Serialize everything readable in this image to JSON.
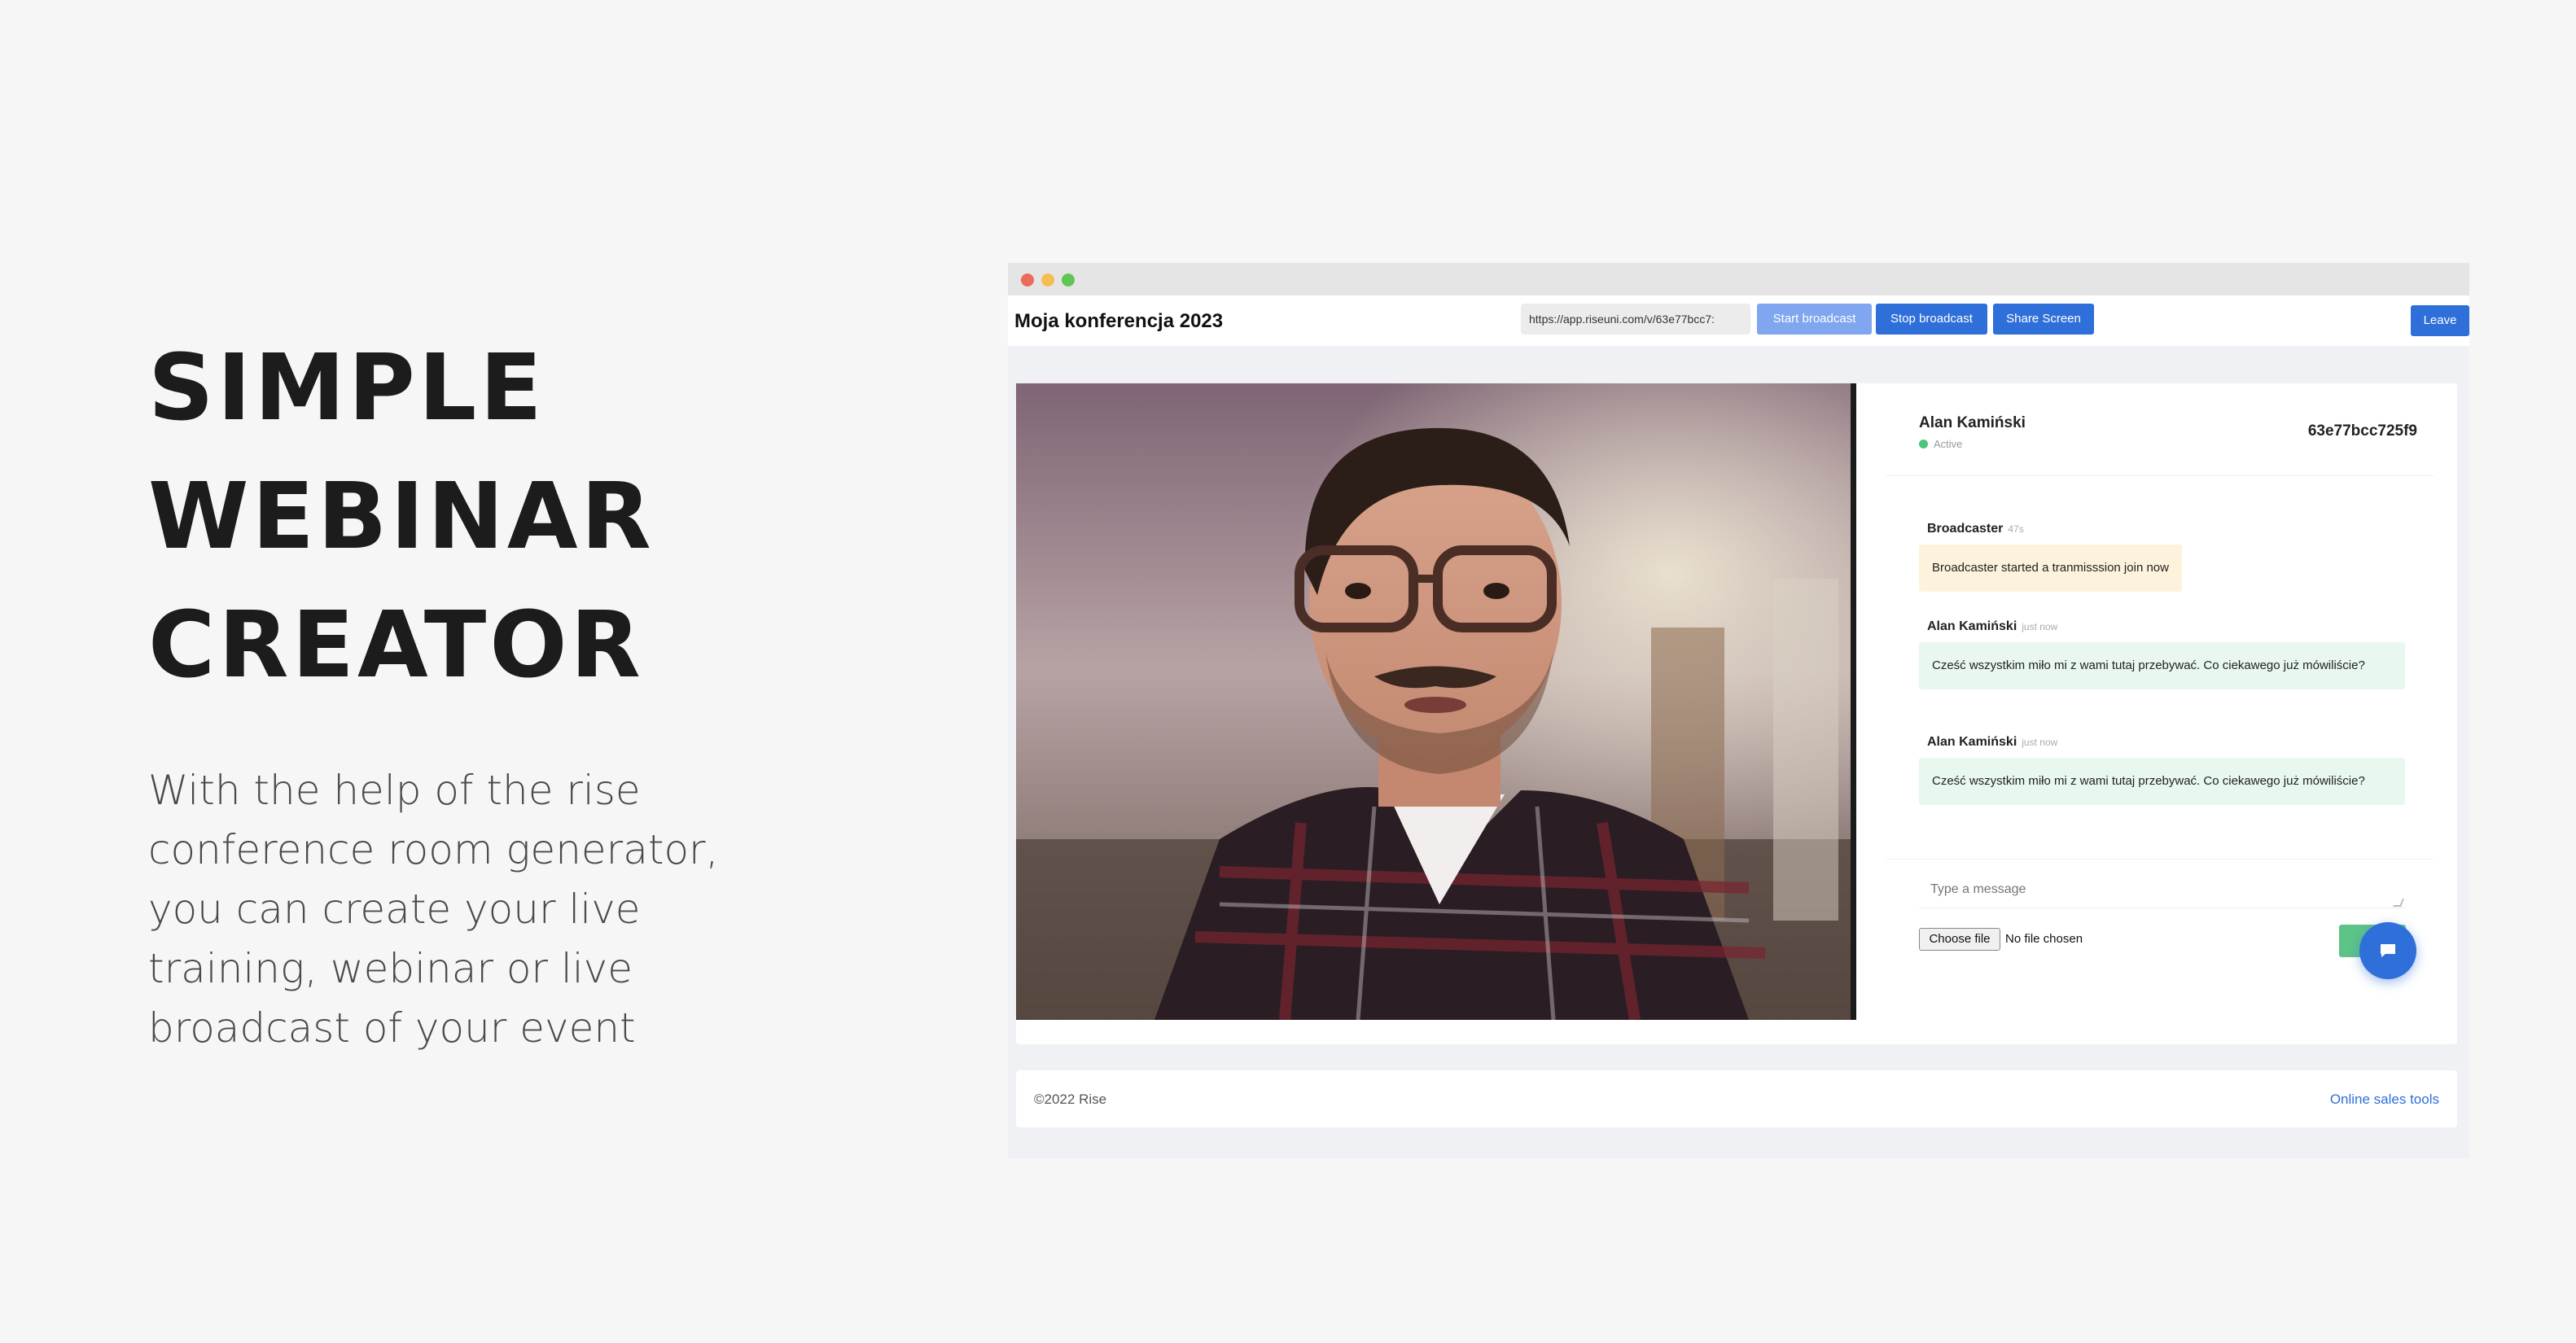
{
  "hero": {
    "title_lines": [
      "SIMPLE",
      "WEBINAR",
      "CREATOR"
    ],
    "description": "With the help of the rise conference room generator, you can create your live training, webinar or live broadcast of your event"
  },
  "window": {
    "app_title": "Moja konferencja 2023",
    "url_value": "https://app.riseuni.com/v/63e77bcc7:",
    "buttons": {
      "start_broadcast": "Start broadcast",
      "stop_broadcast": "Stop broadcast",
      "share_screen": "Share Screen",
      "leave": "Leave"
    }
  },
  "chat": {
    "user_name": "Alan Kamiński",
    "status": "Active",
    "room_id": "63e77bcc725f9",
    "messages": [
      {
        "author": "Broadcaster",
        "time": "47s",
        "text": "Broadcaster started a tranmisssion join now",
        "style": "system"
      },
      {
        "author": "Alan Kamiński",
        "time": "just now",
        "text": "Cześć wszystkim miło mi z wami tutaj przebywać. Co ciekawego już mówiliście?",
        "style": "user"
      },
      {
        "author": "Alan Kamiński",
        "time": "just now",
        "text": "Cześć wszystkim miło mi z wami tutaj przebywać. Co ciekawego już mówiliście?",
        "style": "user"
      }
    ],
    "input_placeholder": "Type a message",
    "choose_file_label": "Choose file",
    "file_status": "No file chosen",
    "send_label": "Se"
  },
  "footer": {
    "copyright": "©2022 Rise",
    "link": "Online sales tools"
  },
  "colors": {
    "primary": "#2f6fd9",
    "primary_disabled": "#7fa6ef",
    "success": "#5dc487",
    "system_bubble": "#fdf3dc",
    "user_bubble": "#e8f8ef"
  }
}
